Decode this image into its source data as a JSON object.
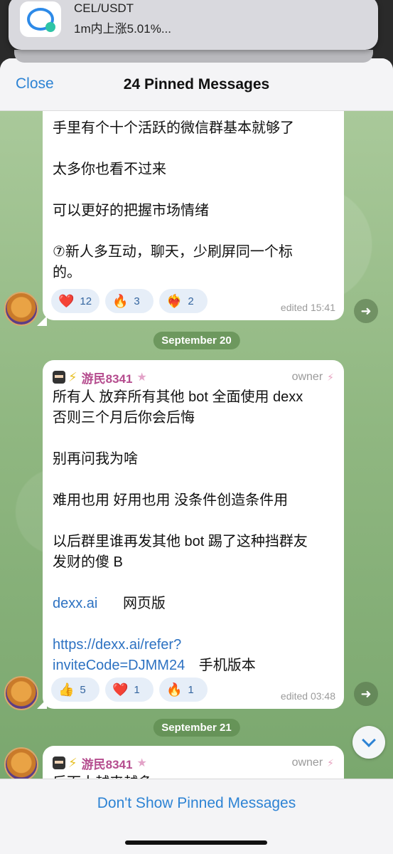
{
  "notification": {
    "title": "CEL/USDT",
    "body": "1m内上涨5.01%..."
  },
  "header": {
    "close_label": "Close",
    "title": "24 Pinned Messages"
  },
  "messages": [
    {
      "lines": [
        "手里有个十个活跃的微信群基本就够了",
        "",
        "太多你也看不过来",
        "",
        "可以更好的把握市场情绪",
        "",
        "⑦新人多互动，聊天，少刷屏同一个标",
        "的。"
      ],
      "reactions": [
        {
          "emoji": "❤️",
          "count": "12"
        },
        {
          "emoji": "🔥",
          "count": "3"
        },
        {
          "emoji": "❤️‍🔥",
          "count": "2"
        }
      ],
      "edited": "edited 15:41"
    },
    {
      "sender": "游民8341",
      "role": "owner",
      "lines": [
        "所有人 放弃所有其他 bot 全面使用 dexx",
        "否则三个月后你会后悔",
        "",
        "别再问我为啥",
        "",
        "难用也用 好用也用 没条件创造条件用",
        "",
        "以后群里谁再发其他 bot 踢了这种挡群友",
        "发财的傻 B",
        ""
      ],
      "link1": "dexx.ai",
      "link1_suffix": "网页版",
      "link2_line1": "https://dexx.ai/refer?",
      "link2_line2": "inviteCode=DJMM24",
      "link2_suffix": "手机版本",
      "reactions": [
        {
          "emoji": "👍",
          "count": "5"
        },
        {
          "emoji": "❤️",
          "count": "1"
        },
        {
          "emoji": "🔥",
          "count": "1"
        }
      ],
      "edited": "edited 03:48"
    },
    {
      "sender": "游民8341",
      "role": "owner",
      "text": "后面人越来越多"
    }
  ],
  "dates": [
    "September 20",
    "September 21"
  ],
  "footer": {
    "dont_show_label": "Don't Show Pinned Messages"
  },
  "colors": {
    "accent": "#2d83d4",
    "sender": "#b54c8e",
    "chat_bg": "#91b882"
  }
}
